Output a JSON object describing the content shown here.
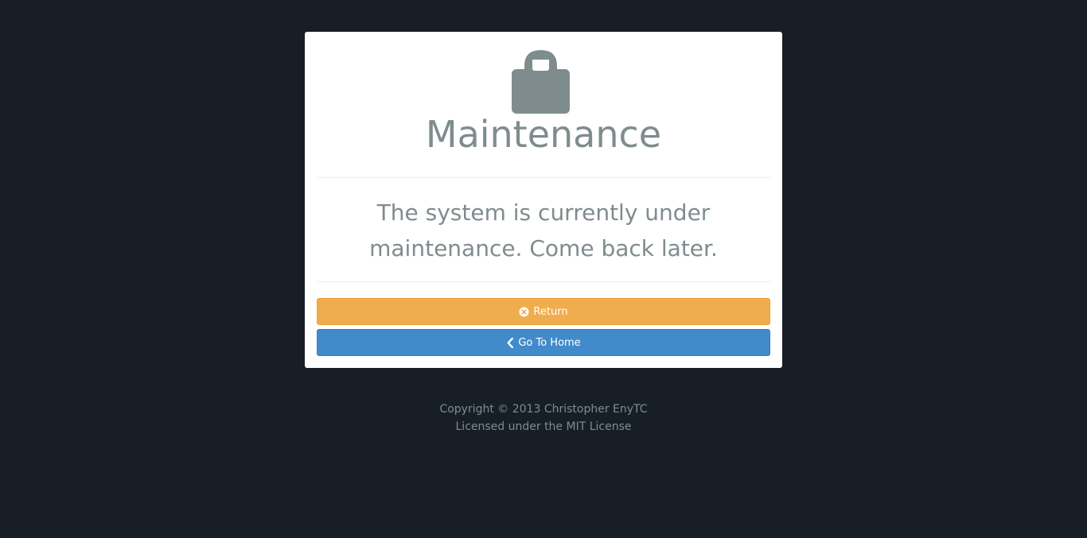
{
  "card": {
    "icon": "lock-icon",
    "title": "Maintenance",
    "message": "The system is currently under maintenance. Come back later."
  },
  "buttons": {
    "return_label": "Return",
    "return_icon": "circle-x-icon",
    "home_label": "Go To Home",
    "home_icon": "chevron-left-icon"
  },
  "footer": {
    "copyright": "Copyright © 2013 Christopher EnyTC",
    "license": "Licensed under the MIT License"
  },
  "colors": {
    "background": "#181e26",
    "card": "#ffffff",
    "text_muted": "#7f8c8d",
    "warning": "#f0ad4e",
    "primary": "#428bca"
  }
}
